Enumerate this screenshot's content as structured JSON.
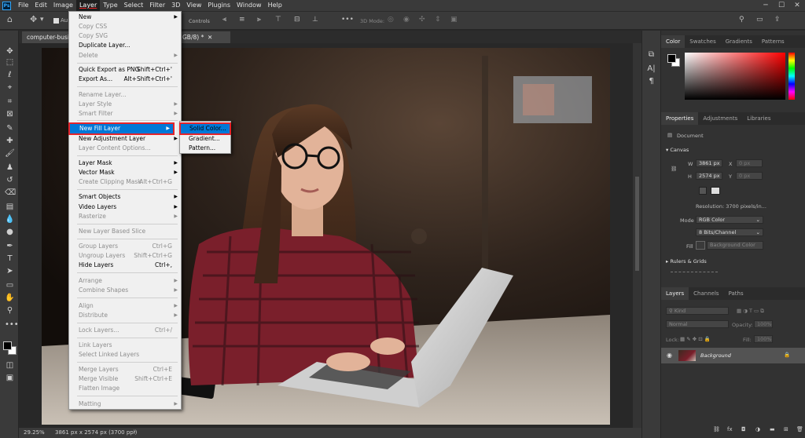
{
  "app": {
    "logo_text": "Ps"
  },
  "menubar": [
    "File",
    "Edit",
    "Image",
    "Layer",
    "Type",
    "Select",
    "Filter",
    "3D",
    "View",
    "Plugins",
    "Window",
    "Help"
  ],
  "options_bar": {
    "auto_select": "Au",
    "controls": "Controls",
    "mode_3d": "3D Mode:"
  },
  "document_tab": {
    "title": "computer-business...",
    "suffix": "GB/8) *"
  },
  "status": {
    "zoom": "29.25%",
    "info": "3861 px x 2574 px (3700 ppi)"
  },
  "layer_menu": {
    "items": [
      {
        "label": "New",
        "enabled": true,
        "submenu": true
      },
      {
        "label": "Copy CSS",
        "enabled": false
      },
      {
        "label": "Copy SVG",
        "enabled": false
      },
      {
        "label": "Duplicate Layer...",
        "enabled": true
      },
      {
        "label": "Delete",
        "enabled": false,
        "submenu": true
      },
      {
        "label": "Quick Export as PNG",
        "enabled": true,
        "shortcut": "Shift+Ctrl+'"
      },
      {
        "label": "Export As...",
        "enabled": true,
        "shortcut": "Alt+Shift+Ctrl+'"
      },
      {
        "label": "Rename Layer...",
        "enabled": false
      },
      {
        "label": "Layer Style",
        "enabled": false,
        "submenu": true
      },
      {
        "label": "Smart Filter",
        "enabled": false,
        "submenu": true
      },
      {
        "label": "New Fill Layer",
        "enabled": true,
        "submenu": true,
        "highlighted": true
      },
      {
        "label": "New Adjustment Layer",
        "enabled": true,
        "submenu": true
      },
      {
        "label": "Layer Content Options...",
        "enabled": false
      },
      {
        "label": "Layer Mask",
        "enabled": true,
        "submenu": true
      },
      {
        "label": "Vector Mask",
        "enabled": true,
        "submenu": true
      },
      {
        "label": "Create Clipping Mask",
        "enabled": false,
        "shortcut": "Alt+Ctrl+G"
      },
      {
        "label": "Smart Objects",
        "enabled": true,
        "submenu": true
      },
      {
        "label": "Video Layers",
        "enabled": true,
        "submenu": true
      },
      {
        "label": "Rasterize",
        "enabled": false,
        "submenu": true
      },
      {
        "label": "New Layer Based Slice",
        "enabled": false
      },
      {
        "label": "Group Layers",
        "enabled": false,
        "shortcut": "Ctrl+G"
      },
      {
        "label": "Ungroup Layers",
        "enabled": false,
        "shortcut": "Shift+Ctrl+G"
      },
      {
        "label": "Hide Layers",
        "enabled": true,
        "shortcut": "Ctrl+,"
      },
      {
        "label": "Arrange",
        "enabled": false,
        "submenu": true
      },
      {
        "label": "Combine Shapes",
        "enabled": false,
        "submenu": true
      },
      {
        "label": "Align",
        "enabled": false,
        "submenu": true
      },
      {
        "label": "Distribute",
        "enabled": false,
        "submenu": true
      },
      {
        "label": "Lock Layers...",
        "enabled": false,
        "shortcut": "Ctrl+/"
      },
      {
        "label": "Link Layers",
        "enabled": false
      },
      {
        "label": "Select Linked Layers",
        "enabled": false
      },
      {
        "label": "Merge Layers",
        "enabled": false,
        "shortcut": "Ctrl+E"
      },
      {
        "label": "Merge Visible",
        "enabled": false,
        "shortcut": "Shift+Ctrl+E"
      },
      {
        "label": "Flatten Image",
        "enabled": false
      },
      {
        "label": "Matting",
        "enabled": false,
        "submenu": true
      }
    ]
  },
  "fill_submenu": [
    "Solid Color...",
    "Gradient...",
    "Pattern..."
  ],
  "color_panel": {
    "tabs": [
      "Color",
      "Swatches",
      "Gradients",
      "Patterns"
    ]
  },
  "properties_panel": {
    "tabs": [
      "Properties",
      "Adjustments",
      "Libraries"
    ],
    "document_label": "Document",
    "canvas_title": "Canvas",
    "w_label": "W",
    "w_value": "3861 px",
    "h_label": "H",
    "h_value": "2574 px",
    "x_label": "X",
    "x_placeholder": "0 px",
    "y_label": "Y",
    "y_placeholder": "0 px",
    "resolution": "Resolution:  3700 pixels/in...",
    "mode_label": "Mode",
    "mode_value": "RGB Color",
    "bits_value": "8 Bits/Channel",
    "fill_label": "Fill",
    "fill_value": "Background Color",
    "rulers_title": "Rulers & Grids"
  },
  "layers_panel": {
    "tabs": [
      "Layers",
      "Channels",
      "Paths"
    ],
    "kind_placeholder": "Kind",
    "blend_mode": "Normal",
    "opacity_label": "Opacity:",
    "opacity_value": "100%",
    "lock_label": "Lock:",
    "fill_label": "Fill:",
    "fill_value": "100%",
    "layers": [
      {
        "name": "Background"
      }
    ]
  },
  "colors": {
    "accent": "#0078d7",
    "highlight_outline": "#e3242b",
    "bg": "#282828"
  }
}
